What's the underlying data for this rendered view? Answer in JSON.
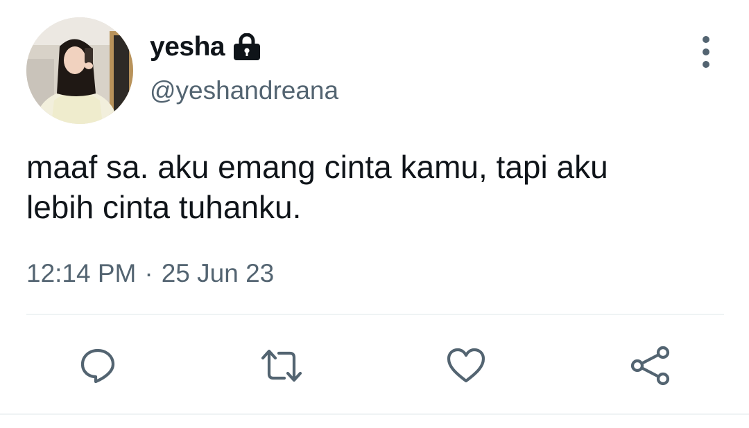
{
  "user": {
    "display_name": "yesha",
    "handle": "@yeshandreana",
    "protected_icon": "lock-icon",
    "avatar": "profile-photo"
  },
  "tweet": {
    "text": "maaf sa. aku emang cinta kamu, tapi aku\nlebih cinta tuhanku.",
    "time": "12:14 PM",
    "separator": "·",
    "date": "25 Jun 23"
  },
  "menu": {
    "icon": "more-vertical-icon"
  },
  "actions": [
    {
      "name": "reply",
      "icon": "reply-icon"
    },
    {
      "name": "retweet",
      "icon": "retweet-icon"
    },
    {
      "name": "like",
      "icon": "heart-icon"
    },
    {
      "name": "share",
      "icon": "share-icon"
    }
  ],
  "colors": {
    "primary_text": "#0f1419",
    "secondary_text": "#536471",
    "divider": "#eff3f4"
  }
}
